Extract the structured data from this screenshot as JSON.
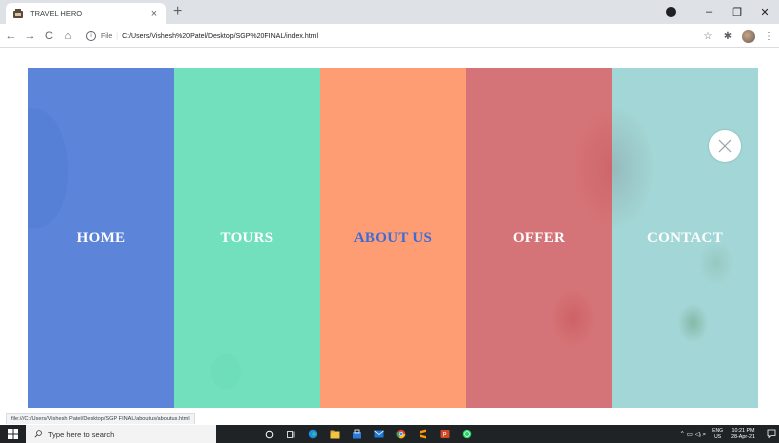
{
  "browser": {
    "tab": {
      "title": "TRAVEL HERO",
      "close": "×"
    },
    "new_tab": "+",
    "window_controls": {
      "minimize": "–",
      "maximize": "❐",
      "close": "✕"
    },
    "address": {
      "info": "i",
      "scheme": "File",
      "separator": "|",
      "url": "C:/Users/Vishesh%20Patel/Desktop/SGP%20FINAL/index.html"
    },
    "nav": {
      "back": "←",
      "forward": "→",
      "reload": "C",
      "home": "⌂"
    },
    "toolbar_icons": {
      "star": "☆",
      "extensions": "✱",
      "menu": "⋮"
    },
    "status_url": "file:///C:/Users/Vishesh Patel/Desktop/SGP FINAL/aboutus/aboutus.html"
  },
  "menu": {
    "items": [
      {
        "label": "HOME",
        "color": "#ffffff"
      },
      {
        "label": "TOURS",
        "color": "#ffffff"
      },
      {
        "label": "ABOUT US",
        "color": "#3a6bd6"
      },
      {
        "label": "OFFER",
        "color": "#ffffff"
      },
      {
        "label": "CONTACT",
        "color": "#ffffff"
      }
    ],
    "colors": {
      "home": "#4673d4",
      "tours": "#67ddb7",
      "about": "#fe986e",
      "offer": "#ce5c60",
      "contact": "#80c6c6"
    },
    "close_icon": "close-icon"
  },
  "taskbar": {
    "search_placeholder": "Type here to search",
    "tray": {
      "lang_top": "ENG",
      "lang_bottom": "US",
      "time": "10:21 PM",
      "date": "28-Apr-21",
      "sys": "⌃ ▭ ◁ᵢ ⌕"
    }
  }
}
